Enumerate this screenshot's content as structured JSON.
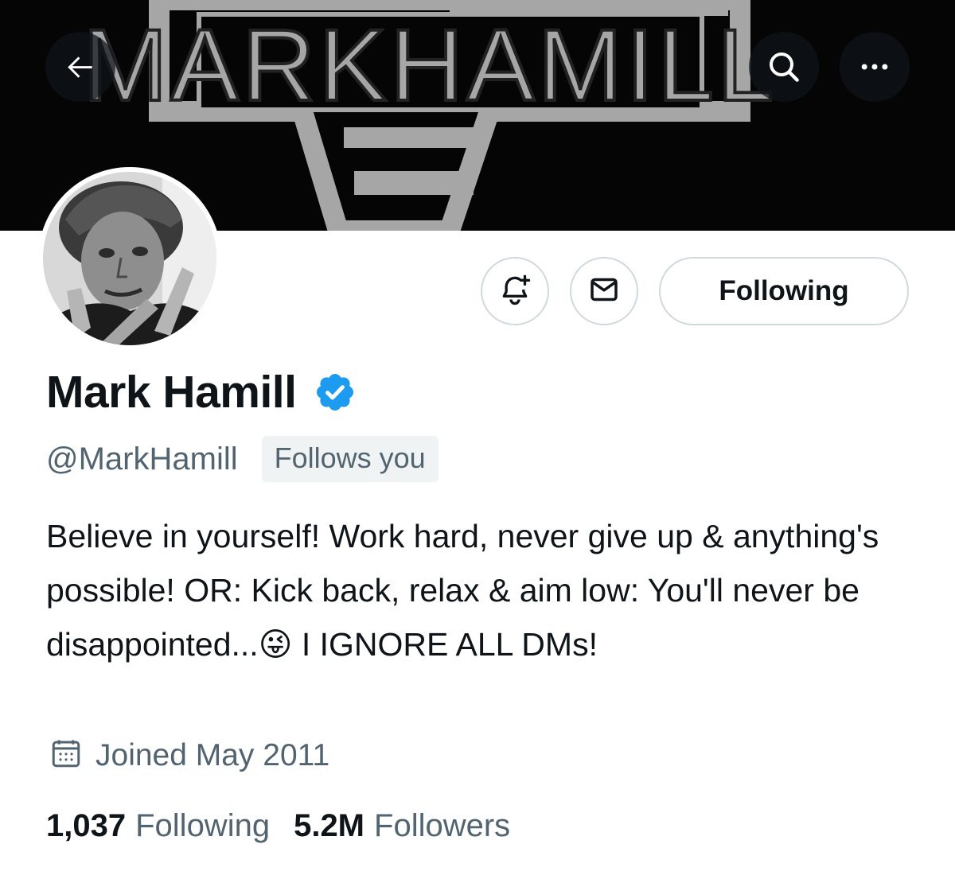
{
  "header": {
    "back_icon": "arrow-left-icon",
    "search_icon": "search-icon",
    "more_icon": "more-icon"
  },
  "banner": {
    "text": "MARKHAMILL",
    "bg_color": "#050505",
    "art_color": "#a6a6a6"
  },
  "actions": {
    "notify_icon": "bell-plus-icon",
    "message_icon": "envelope-icon",
    "follow_label": "Following"
  },
  "profile": {
    "name": "Mark Hamill",
    "verified_color": "#1d9bf0",
    "handle": "@MarkHamill",
    "follows_you": "Follows you",
    "bio": "Believe in yourself! Work hard, never give up & anything's possible! OR: Kick back, relax & aim low: You'll never be disappointed...😜 I IGNORE ALL DMs!",
    "joined": "Joined May 2011"
  },
  "stats": {
    "following_count": "1,037",
    "following_label": "Following",
    "followers_count": "5.2M",
    "followers_label": "Followers"
  }
}
